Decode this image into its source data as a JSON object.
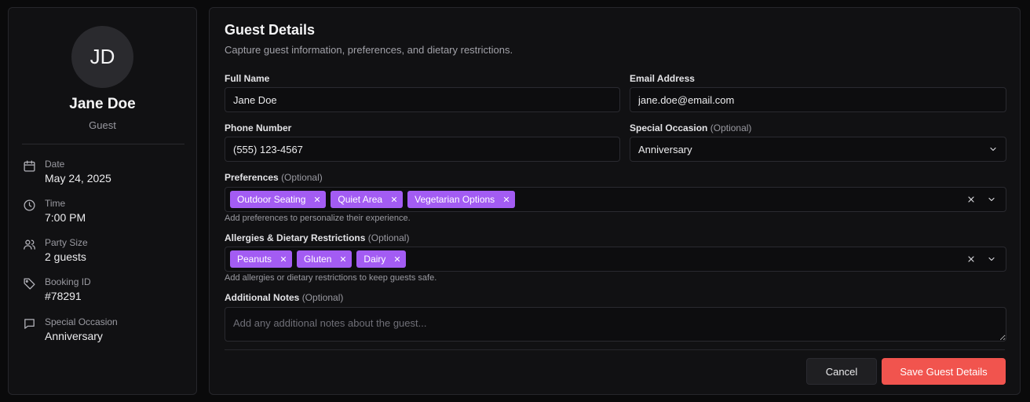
{
  "profile": {
    "initials": "JD",
    "name": "Jane Doe",
    "role": "Guest"
  },
  "booking_info": [
    {
      "icon": "calendar-icon",
      "label": "Date",
      "value": "May 24, 2025"
    },
    {
      "icon": "clock-icon",
      "label": "Time",
      "value": "7:00 PM"
    },
    {
      "icon": "users-icon",
      "label": "Party Size",
      "value": "2 guests"
    },
    {
      "icon": "tag-icon",
      "label": "Booking ID",
      "value": "#78291"
    },
    {
      "icon": "message-icon",
      "label": "Special Occasion",
      "value": "Anniversary"
    }
  ],
  "form": {
    "title": "Guest Details",
    "subtitle": "Capture guest information, preferences, and dietary restrictions.",
    "full_name": {
      "label": "Full Name",
      "value": "Jane Doe"
    },
    "email": {
      "label": "Email Address",
      "value": "jane.doe@email.com"
    },
    "phone": {
      "label": "Phone Number",
      "value": "(555) 123-4567"
    },
    "occasion": {
      "label": "Special Occasion",
      "optional": "(Optional)",
      "value": "Anniversary"
    },
    "preferences": {
      "label": "Preferences",
      "optional": "(Optional)",
      "chips": [
        "Outdoor Seating",
        "Quiet Area",
        "Vegetarian Options"
      ],
      "helper": "Add preferences to personalize their experience."
    },
    "allergies": {
      "label": "Allergies & Dietary Restrictions",
      "optional": "(Optional)",
      "chips": [
        "Peanuts",
        "Gluten",
        "Dairy"
      ],
      "helper": "Add allergies or dietary restrictions to keep guests safe."
    },
    "notes": {
      "label": "Additional Notes",
      "optional": "(Optional)",
      "placeholder": "Add any additional notes about the guest..."
    },
    "cancel_label": "Cancel",
    "save_label": "Save Guest Details"
  },
  "colors": {
    "accent": "#f1544e",
    "chip": "#a35cf3",
    "background": "#0a0a0b",
    "panel": "#111113"
  }
}
